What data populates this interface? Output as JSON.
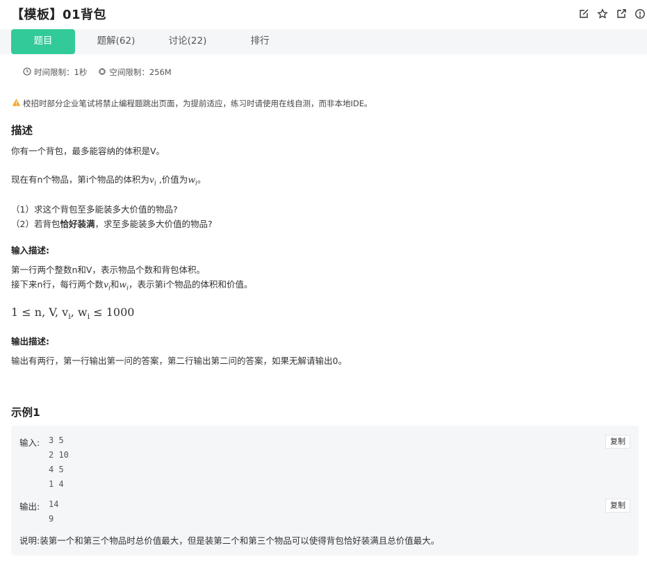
{
  "header": {
    "title": "【模板】01背包",
    "icons": [
      "edit-icon",
      "star-icon",
      "share-icon",
      "report-icon"
    ]
  },
  "tabs": [
    {
      "label": "题目",
      "active": true
    },
    {
      "label": "题解(62)",
      "active": false
    },
    {
      "label": "讨论(22)",
      "active": false
    },
    {
      "label": "排行",
      "active": false
    }
  ],
  "limits": {
    "time": "时间限制：1秒",
    "space": "空间限制：256M"
  },
  "notice": "校招时部分企业笔试将禁止编程题跳出页面，为提前适应，练习时请使用在线自测，而非本地IDE。",
  "description": {
    "heading": "描述",
    "line1": "你有一个背包，最多能容纳的体积是V。",
    "line2_prefix": "现在有n个物品，第i个物品的体积为",
    "line2_var1": "v",
    "line2_sub1": "i",
    "line2_mid": " ,价值为",
    "line2_var2": "w",
    "line2_sub2": "i",
    "line2_suffix": "。",
    "q1": "（1）求这个背包至多能装多大价值的物品?",
    "q2_prefix": "（2）若背包",
    "q2_bold": "恰好装满",
    "q2_suffix": "，求至多能装多大价值的物品?"
  },
  "input_desc": {
    "heading": "输入描述:",
    "line1": "第一行两个整数n和V，表示物品个数和背包体积。",
    "line2_prefix": "接下来n行，每行两个数",
    "line2_var1": "v",
    "line2_sub1": "i",
    "line2_mid": "和",
    "line2_var2": "w",
    "line2_sub2": "i",
    "line2_suffix": "，表示第i个物品的体积和价值。",
    "constraint": "1 ≤ n, V, v",
    "constraint_sub1": "i",
    "constraint_mid": ", w",
    "constraint_sub2": "i",
    "constraint_suffix": " ≤ 1000"
  },
  "output_desc": {
    "heading": "输出描述:",
    "line1": "输出有两行，第一行输出第一问的答案，第二行输出第二问的答案，如果无解请输出0。"
  },
  "example": {
    "heading": "示例1",
    "input_label": "输入:",
    "input_value": "3 5\n2 10\n4 5\n1 4",
    "output_label": "输出:",
    "output_value": "14\n9",
    "copy_label": "复制",
    "explain_label": "说明:",
    "explain_text": "装第一个和第三个物品时总价值最大，但是装第二个和第三个物品可以使得背包恰好装满且总价值最大。"
  },
  "colors": {
    "accent": "#32ca99",
    "warning": "#f5a623"
  }
}
